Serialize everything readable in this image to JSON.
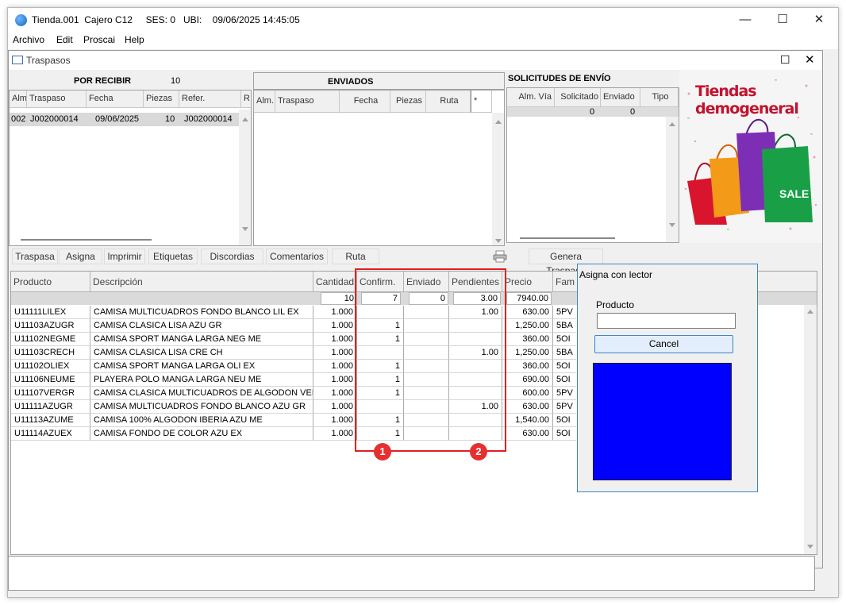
{
  "window": {
    "title": "Tienda.001  Cajero C12     SES: 0   UBI:    09/06/2025 14:45:05",
    "minimize": "—",
    "maximize": "☐",
    "close": "✕"
  },
  "menu": [
    "Archivo",
    "Edit",
    "Proscai",
    "Help"
  ],
  "doc": {
    "title": "Traspasos",
    "maximize": "☐",
    "close": "✕"
  },
  "por_recibir": {
    "title": "POR RECIBIR",
    "count": "10",
    "headers": [
      "Alm",
      "Traspaso",
      "Fecha",
      "Piezas",
      "Refer.",
      "R"
    ],
    "rows": [
      {
        "alm": "002",
        "traspaso": "J002000014",
        "fecha": "09/06/2025",
        "piezas": "10",
        "refer": "J002000014"
      }
    ]
  },
  "enviados": {
    "title": "ENVIADOS",
    "headers": [
      "Alm.",
      "Traspaso",
      "Fecha",
      "Piezas",
      "Ruta",
      "*"
    ]
  },
  "solicitudes": {
    "title": "SOLICITUDES DE ENVÍO",
    "headers": [
      "Alm.",
      "Vía",
      "Solicitado",
      "Enviado",
      "Tipo"
    ],
    "total_solicitado": "0",
    "total_enviado": "0"
  },
  "ad": {
    "line1": "Tiendas",
    "line2": "demogeneral",
    "sale": "SALE"
  },
  "toolbar": {
    "traspasa": "Traspasa",
    "asigna": "Asigna",
    "imprimir": "Imprimir",
    "etiquetas": "Etiquetas",
    "discordias": "Discordias",
    "comentarios": "Comentarios",
    "ruta": "Ruta",
    "genera": "Genera Traspaso"
  },
  "table": {
    "headers": {
      "producto": "Producto",
      "descripcion": "Descripción",
      "cantidad": "Cantidad",
      "confirm": "Confirm.",
      "enviado": "Enviado",
      "pendientes": "Pendientes",
      "precio": "Precio",
      "fam": "Fam S"
    },
    "totals": {
      "cantidad": "10",
      "confirm": "7",
      "enviado": "0",
      "pendientes": "3.00",
      "precio": "7940.00"
    },
    "rows": [
      {
        "producto": "U11111LILEX",
        "descripcion": "CAMISA MULTICUADROS FONDO BLANCO LIL EX",
        "cantidad": "1.000",
        "confirm": "",
        "enviado": "",
        "pendientes": "1.00",
        "precio": "630.00",
        "fam": "5PV"
      },
      {
        "producto": "U11103AZUGR",
        "descripcion": "CAMISA CLASICA LISA AZU GR",
        "cantidad": "1.000",
        "confirm": "1",
        "enviado": "",
        "pendientes": "",
        "precio": "1,250.00",
        "fam": "5BA"
      },
      {
        "producto": "U11102NEGME",
        "descripcion": "CAMISA SPORT MANGA LARGA NEG ME",
        "cantidad": "1.000",
        "confirm": "1",
        "enviado": "",
        "pendientes": "",
        "precio": "360.00",
        "fam": "5OI"
      },
      {
        "producto": "U11103CRECH",
        "descripcion": "CAMISA CLASICA LISA CRE CH",
        "cantidad": "1.000",
        "confirm": "",
        "enviado": "",
        "pendientes": "1.00",
        "precio": "1,250.00",
        "fam": "5BA"
      },
      {
        "producto": "U11102OLIEX",
        "descripcion": "CAMISA SPORT MANGA LARGA OLI EX",
        "cantidad": "1.000",
        "confirm": "1",
        "enviado": "",
        "pendientes": "",
        "precio": "360.00",
        "fam": "5OI"
      },
      {
        "producto": "U11106NEUME",
        "descripcion": "PLAYERA POLO MANGA LARGA NEU ME",
        "cantidad": "1.000",
        "confirm": "1",
        "enviado": "",
        "pendientes": "",
        "precio": "690.00",
        "fam": "5OI"
      },
      {
        "producto": "U11107VERGR",
        "descripcion": "CAMISA CLASICA MULTICUADROS DE ALGODON VER",
        "cantidad": "1.000",
        "confirm": "1",
        "enviado": "",
        "pendientes": "",
        "precio": "600.00",
        "fam": "5PV"
      },
      {
        "producto": "U11111AZUGR",
        "descripcion": "CAMISA MULTICUADROS FONDO BLANCO AZU GR",
        "cantidad": "1.000",
        "confirm": "",
        "enviado": "",
        "pendientes": "1.00",
        "precio": "630.00",
        "fam": "5PV"
      },
      {
        "producto": "U11113AZUME",
        "descripcion": "CAMISA 100% ALGODON IBERIA AZU ME",
        "cantidad": "1.000",
        "confirm": "1",
        "enviado": "",
        "pendientes": "",
        "precio": "1,540.00",
        "fam": "5OI"
      },
      {
        "producto": "U11114AZUEX",
        "descripcion": "CAMISA FONDO DE COLOR AZU EX",
        "cantidad": "1.000",
        "confirm": "1",
        "enviado": "",
        "pendientes": "",
        "precio": "630.00",
        "fam": "5OI"
      }
    ]
  },
  "callouts": [
    "1",
    "2"
  ],
  "dialog": {
    "title": "Asigna con lector",
    "producto_label": "Producto",
    "producto_value": "",
    "cancel": "Cancel",
    "preview_color": "#0000ff"
  }
}
